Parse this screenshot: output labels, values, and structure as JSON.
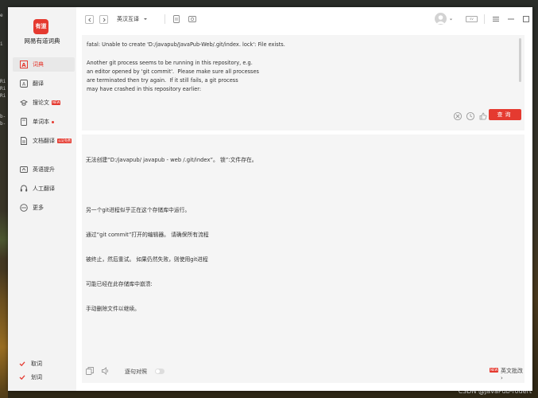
{
  "desktop": {
    "terminal_lines": [
      "e",
      "i",
      "Ri",
      "Ri",
      "Ri",
      "b-",
      "b-"
    ],
    "watermark": "CSDN @JavaPub-rodert"
  },
  "app": {
    "logo_text": "有道",
    "name": "网易有道词典"
  },
  "sidebar": {
    "items": [
      {
        "label": "词典",
        "icon": "dictionary-icon",
        "active": true
      },
      {
        "label": "翻译",
        "icon": "translate-icon"
      },
      {
        "label": "搜论文",
        "icon": "paper-search-icon",
        "badge": "NEW"
      },
      {
        "label": "单词本",
        "icon": "wordbook-icon"
      },
      {
        "label": "文档翻译",
        "icon": "document-translate-icon",
        "badge": "认证免费"
      },
      {
        "label": "英语提升",
        "icon": "english-up-icon"
      },
      {
        "label": "人工翻译",
        "icon": "human-translate-icon"
      },
      {
        "label": "更多",
        "icon": "more-icon"
      }
    ],
    "bottom": [
      {
        "label": "取词",
        "checked": true
      },
      {
        "label": "划词",
        "checked": true
      }
    ]
  },
  "topbar": {
    "language_mode": "英汉互译",
    "badge_text": "sv"
  },
  "input": {
    "text": "fatal: Unable to create 'D:/javapub/JavaPub-Web/.git/index. lock': File exists.\n\nAnother git process seems to be running in this repository, e.g.\nan editor opened by 'git commit'.  Please make sure all processes\nare terminated then try again.  If it still fails, a git process\nmay have crashed in this repository earlier:",
    "query_label": "查询"
  },
  "output": {
    "lines": [
      "无法创建“D:/javapub/ javapub - web /.git/index”。 锁”:文件存在。",
      "另一个git进程似乎正在这个存储库中运行。",
      "通过“git commit”打开的编辑器。 请确保所有流程",
      "被终止，然后重试。 如果仍然失败，则使用git进程",
      "可能已经在此存储库中崩溃:",
      "手动删除文件以继续。"
    ],
    "sentence_align_label": "逐句对照",
    "engine_badge": "NEW",
    "engine_label": "英文批改 ›"
  },
  "colors": {
    "accent": "#e53a30",
    "sidebar_bg": "#f3f3f3",
    "panel_bg": "#f5f5f5"
  }
}
